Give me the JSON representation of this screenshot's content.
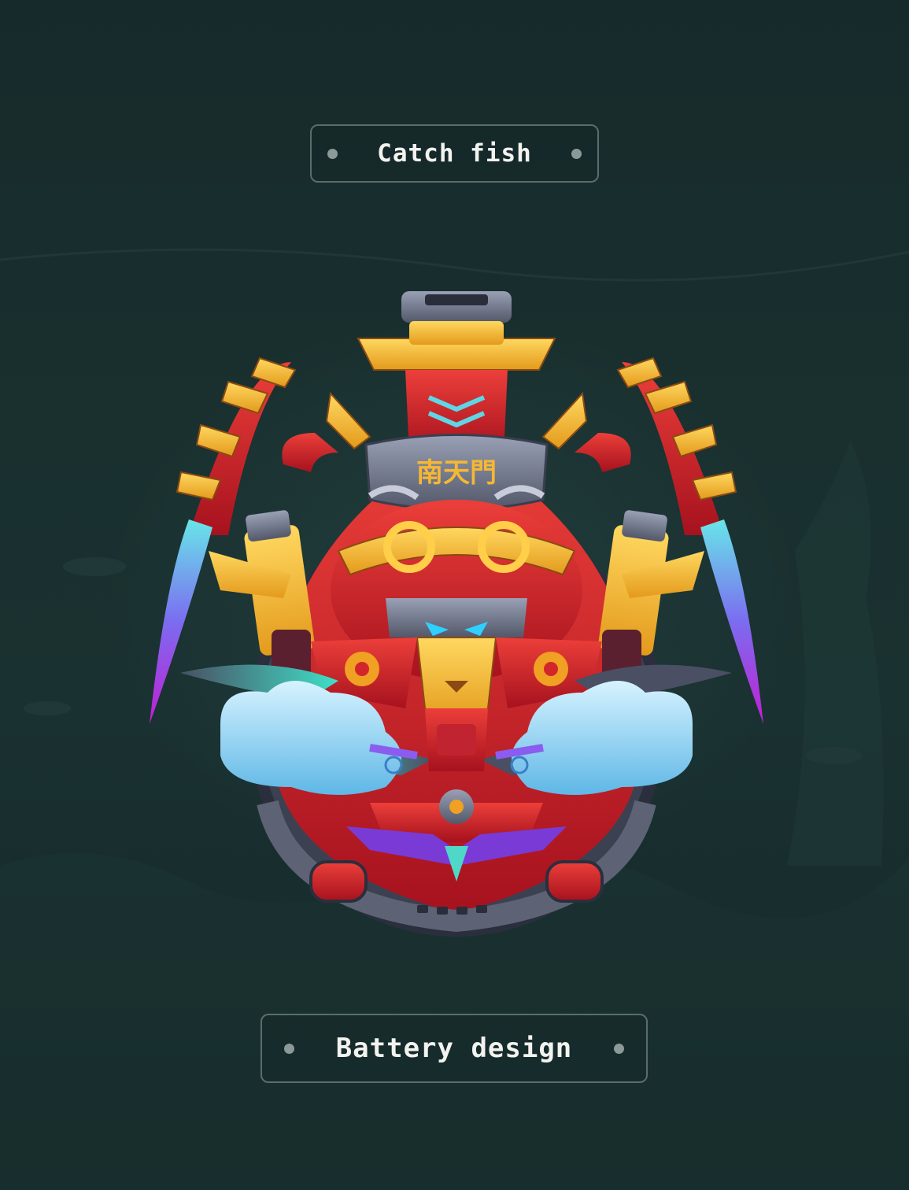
{
  "header": {
    "title": "Catch fish"
  },
  "artwork": {
    "plaque_text": "南天門",
    "icon": "monkey-king-turret-icon"
  },
  "footer": {
    "title": "Battery design"
  },
  "colors": {
    "background": "#162a2a",
    "badge_border": "#5b6c6c",
    "badge_dot": "#8b9a98",
    "turret_red": "#d3262b",
    "turret_gold": "#f2b631",
    "cloud_blue": "#8ad4ef",
    "metal_grey": "#6f7486"
  }
}
